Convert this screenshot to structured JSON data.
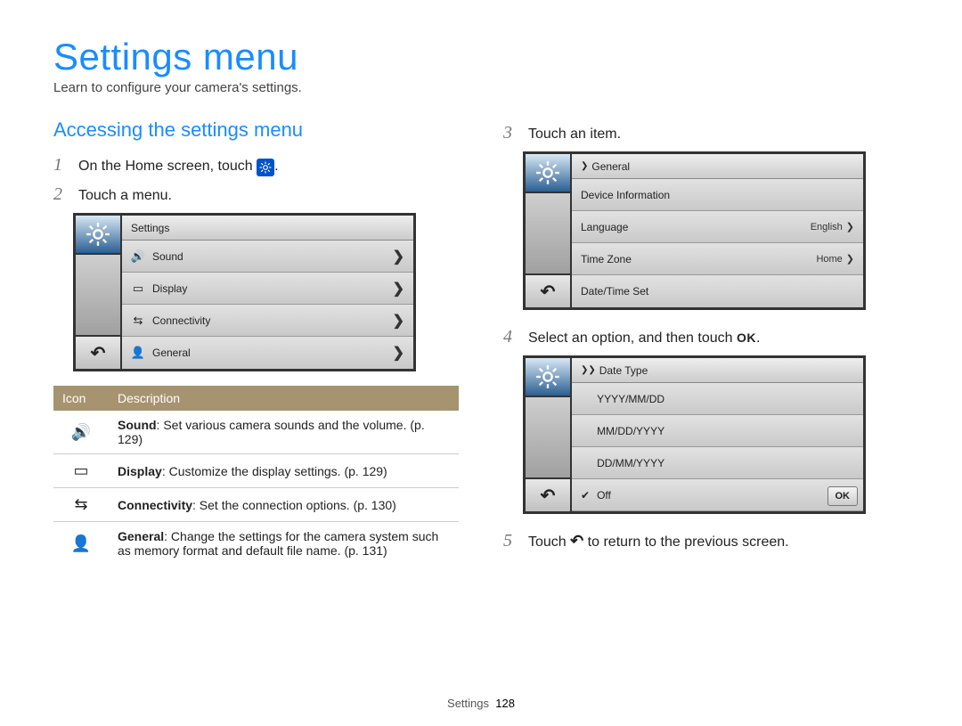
{
  "title": "Settings menu",
  "subtitle": "Learn to configure your camera's settings.",
  "section_heading": "Accessing the settings menu",
  "steps": {
    "s1_a": "On the Home screen, touch ",
    "s1_b": ".",
    "s2": "Touch a menu.",
    "s3": "Touch an item.",
    "s4_a": "Select an option, and then touch ",
    "s4_b": ".",
    "s5_a": "Touch ",
    "s5_b": " to return to the previous screen."
  },
  "ok_text": "OK",
  "ok_btn_text": "OK",
  "device1": {
    "header": "Settings",
    "rows": [
      {
        "icon": "🔊",
        "label": "Sound"
      },
      {
        "icon": "▭",
        "label": "Display"
      },
      {
        "icon": "⇆",
        "label": "Connectivity"
      },
      {
        "icon": "👤",
        "label": "General"
      }
    ]
  },
  "device2": {
    "header": "General",
    "rows": [
      {
        "label": "Device Information",
        "value": ""
      },
      {
        "label": "Language",
        "value": "English"
      },
      {
        "label": "Time Zone",
        "value": "Home"
      },
      {
        "label": "Date/Time Set",
        "value": ""
      }
    ]
  },
  "device3": {
    "header": "Date Type",
    "rows": [
      {
        "label": "YYYY/MM/DD",
        "checked": false
      },
      {
        "label": "MM/DD/YYYY",
        "checked": false
      },
      {
        "label": "DD/MM/YYYY",
        "checked": false
      },
      {
        "label": "Off",
        "checked": true
      }
    ]
  },
  "table": {
    "head_icon": "Icon",
    "head_desc": "Description",
    "rows": [
      {
        "icon": "🔊",
        "bold": "Sound",
        "text": ": Set various camera sounds and the volume. (p. 129)"
      },
      {
        "icon": "▭",
        "bold": "Display",
        "text": ": Customize the display settings. (p. 129)"
      },
      {
        "icon": "⇆",
        "bold": "Connectivity",
        "text": ": Set the connection options. (p. 130)"
      },
      {
        "icon": "👤",
        "bold": "General",
        "text": ": Change the settings for the camera system such as memory format and default file name. (p. 131)"
      }
    ]
  },
  "footer": {
    "section": "Settings",
    "page": "128"
  }
}
